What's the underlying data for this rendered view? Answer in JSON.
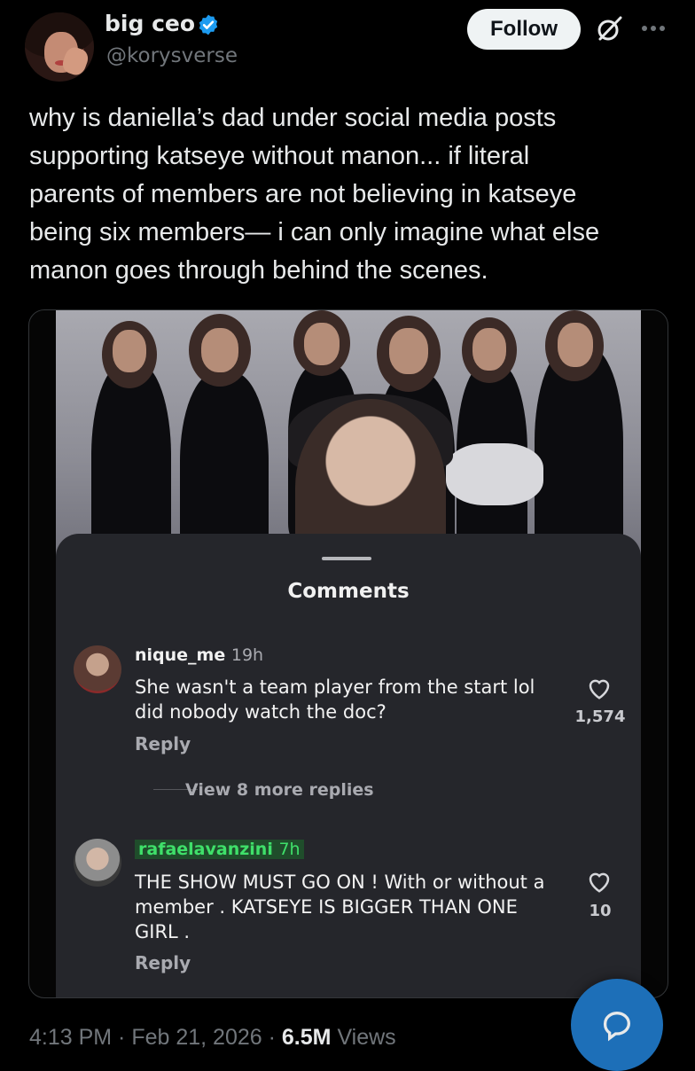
{
  "author": {
    "display_name": "big ceo",
    "handle": "@korysverse",
    "verified": true
  },
  "actions": {
    "follow_label": "Follow"
  },
  "tweet": {
    "text": "why is daniella’s dad under social media posts\nsupporting katseye without manon... if literal\nparents of members are not believing in katseye\nbeing six members— i can only imagine what else\nmanon goes through behind the scenes."
  },
  "embedded": {
    "sheet_title": "Comments",
    "comments": [
      {
        "username": "nique_me",
        "time": "19h",
        "text": "She wasn't a team player from the start lol did nobody watch the doc?",
        "likes": "1,574",
        "reply_label": "Reply"
      },
      {
        "username": "rafaelavanzini",
        "time": "7h",
        "text": "THE SHOW MUST GO ON ! With or without a member . KATSEYE IS BIGGER THAN ONE GIRL .",
        "likes": "10",
        "reply_label": "Reply"
      }
    ],
    "view_more_label": "View 8 more replies"
  },
  "footer": {
    "time": "4:13 PM",
    "date": "Feb 21, 2026",
    "views_count": "6.5M",
    "views_label": "Views"
  },
  "colors": {
    "background": "#000000",
    "verified_badge": "#1d9bf0",
    "fab": "#1d6fb8",
    "highlight": "#3fe06a"
  },
  "icons": [
    "verified-badge-icon",
    "grok-icon",
    "more-icon",
    "heart-icon",
    "chat-bubble-icon"
  ]
}
